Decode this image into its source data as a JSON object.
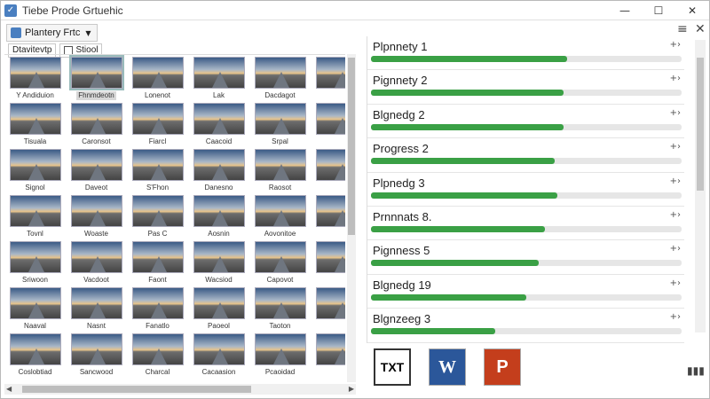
{
  "window": {
    "title": "Tiebe Prode Grtuehic",
    "controls": {
      "minimize": "—",
      "maximize": "☐",
      "close": "✕"
    }
  },
  "toolbar": {
    "dropdown_label": "Plantery Frtc",
    "dropdown_caret": "▼",
    "sub_buttons": [
      {
        "label": "Dtavitevtp"
      },
      {
        "label": "Stiool"
      }
    ]
  },
  "gallery": {
    "items": [
      {
        "caption": "Y Andiduion"
      },
      {
        "caption": "Fhnmdeotn",
        "selected": true
      },
      {
        "caption": "Lonenot"
      },
      {
        "caption": "Lak"
      },
      {
        "caption": "Dacdagot"
      },
      {
        "caption": ""
      },
      {
        "caption": "Tisuala"
      },
      {
        "caption": "Caronsot"
      },
      {
        "caption": "Fiarcl"
      },
      {
        "caption": "Caacoid"
      },
      {
        "caption": "Srpal"
      },
      {
        "caption": ""
      },
      {
        "caption": "Signol"
      },
      {
        "caption": "Daveot"
      },
      {
        "caption": "S'Fhon"
      },
      {
        "caption": "Danesno"
      },
      {
        "caption": "Raosot"
      },
      {
        "caption": ""
      },
      {
        "caption": "Tovnl"
      },
      {
        "caption": "Woaste"
      },
      {
        "caption": "Pas C"
      },
      {
        "caption": "Aosnin"
      },
      {
        "caption": "Aovonitoe"
      },
      {
        "caption": ""
      },
      {
        "caption": "Sriwoon"
      },
      {
        "caption": "Vacdoot"
      },
      {
        "caption": "Faont"
      },
      {
        "caption": "Wacsiod"
      },
      {
        "caption": "Capovot"
      },
      {
        "caption": ""
      },
      {
        "caption": "Naaval"
      },
      {
        "caption": "Nasnt"
      },
      {
        "caption": "Fanatlo"
      },
      {
        "caption": "Paoeol"
      },
      {
        "caption": "Taoton"
      },
      {
        "caption": ""
      },
      {
        "caption": "Coslobtiad"
      },
      {
        "caption": "Sancwood"
      },
      {
        "caption": "Charcal"
      },
      {
        "caption": "Cacaasion"
      },
      {
        "caption": "Pcaoidad"
      },
      {
        "caption": ""
      }
    ]
  },
  "progress": {
    "items": [
      {
        "label": "Plpnnety 1",
        "fraction": 0.63
      },
      {
        "label": "Pignnety 2",
        "fraction": 0.62
      },
      {
        "label": "Blgnedg 2",
        "fraction": 0.62
      },
      {
        "label": "Progress 2",
        "fraction": 0.59
      },
      {
        "label": "Plpnedg 3",
        "fraction": 0.6
      },
      {
        "label": "Prnnnats 8.",
        "fraction": 0.56
      },
      {
        "label": "Pignness 5",
        "fraction": 0.54
      },
      {
        "label": "Blgnedg 19",
        "fraction": 0.5
      },
      {
        "label": "Blgnzeeg 3",
        "fraction": 0.4
      }
    ],
    "row_arrow": "+›",
    "menu_icon": "≡",
    "close_icon": "✕"
  },
  "export": {
    "txt": "TXT",
    "word": "W",
    "ppt": "P"
  },
  "stats_icon": "▮▮▮",
  "colors": {
    "progress_fill": "#3aa045",
    "word_blue": "#2b579a",
    "ppt_red": "#c43e1c"
  }
}
